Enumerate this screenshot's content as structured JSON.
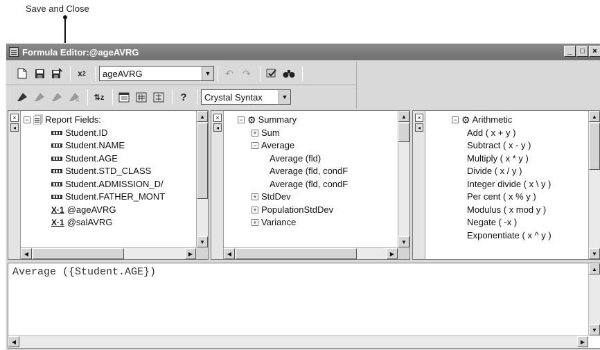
{
  "callout": {
    "label": "Save and Close"
  },
  "window": {
    "title": "Formula Editor:@ageAVRG",
    "controls": {
      "minimize": "_",
      "maximize": "□",
      "close": "×"
    }
  },
  "toolbar": {
    "formula_name": "ageAVRG",
    "syntax": "Crystal Syntax",
    "help_label": "?",
    "icons": [
      "new-icon",
      "save-icon",
      "save-and-close-icon",
      "x2-icon",
      "undo-icon",
      "redo-icon",
      "check-icon",
      "find-icon",
      "bookmark-icon",
      "next-bookmark-icon",
      "prev-bookmark-icon",
      "clear-bookmarks-icon",
      "sort-icon",
      "toggle-fields-icon",
      "toggle-functions-icon",
      "toggle-operators-icon",
      "help-icon"
    ]
  },
  "fields_pane": {
    "root": "Report Fields:",
    "items": [
      "Student.ID",
      "Student.NAME",
      "Student.AGE",
      "Student.STD_CLASS",
      "Student.ADMISSION_D/",
      "Student.FATHER_MONT",
      "@ageAVRG",
      "@salAVRG"
    ]
  },
  "functions_pane": {
    "root": "Summary",
    "items": [
      {
        "label": "Sum",
        "level": 1,
        "expander": "+"
      },
      {
        "label": "Average",
        "level": 1,
        "expander": "−"
      },
      {
        "label": "Average (fld)",
        "level": 2,
        "expander": ""
      },
      {
        "label": "Average (fld, condF",
        "level": 2,
        "expander": ""
      },
      {
        "label": "Average (fld, condF",
        "level": 2,
        "expander": ""
      },
      {
        "label": "StdDev",
        "level": 1,
        "expander": "+"
      },
      {
        "label": "PopulationStdDev",
        "level": 1,
        "expander": "+"
      },
      {
        "label": "Variance",
        "level": 1,
        "expander": "+"
      }
    ]
  },
  "operators_pane": {
    "root": "Arithmetic",
    "items": [
      "Add ( x + y )",
      "Subtract ( x - y )",
      "Multiply ( x * y )",
      "Divide ( x / y )",
      "Integer divide ( x \\ y )",
      "Per cent ( x % y )",
      "Modulus ( x mod y )",
      "Negate ( -x )",
      "Exponentiate ( x ^ y )"
    ]
  },
  "editor": {
    "formula": "Average ({Student.AGE})"
  }
}
